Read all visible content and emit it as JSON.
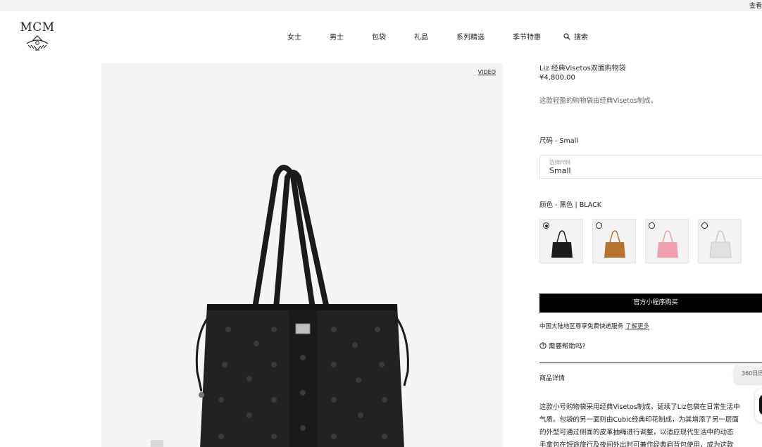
{
  "topbar": {
    "link": "查看"
  },
  "brand": {
    "logo_text": "MCM"
  },
  "nav": {
    "items": [
      "女士",
      "男士",
      "包袋",
      "礼品",
      "系列精选",
      "季节特惠"
    ],
    "search_label": "搜索"
  },
  "gallery": {
    "video_label": "VIDEO"
  },
  "product": {
    "name": "Liz 经典Visetos双面购物袋",
    "price": "¥4,800.00",
    "description": "这款轻盈的购物袋由经典Visetos制成。"
  },
  "size": {
    "label": "尺码 - Small",
    "placeholder": "选择尺码",
    "value": "Small"
  },
  "color": {
    "label": "颜色 - 黑色 | BLACK",
    "swatches": [
      {
        "color": "#1d1d1d",
        "selected": true
      },
      {
        "color": "#b8742f",
        "selected": false
      },
      {
        "color": "#ef9fae",
        "selected": false
      },
      {
        "color": "#d8d8d8",
        "selected": false
      }
    ]
  },
  "buy": {
    "label": "官方小程序购买"
  },
  "shipping": {
    "text": "中国大陆地区尊享免费快递服务",
    "link": "了解更多"
  },
  "help": {
    "label": "需要帮助吗?"
  },
  "details": {
    "title": "商品详情",
    "lines": [
      "这款小号购物袋采用经典Visetos制成，延续了Liz包袋在日常生活中",
      "气质。包袋的另一面则由Cubic经典印花制成，为其增添了另一层面",
      "的外型可通过侧面的皮革抽绳进行调整，以适应现代生活中的动态",
      "手拿包在短途旅行及夜间外出时可兼作经典肩背包使用，成为这款"
    ]
  },
  "floating": {
    "tab_label": "360日历"
  }
}
